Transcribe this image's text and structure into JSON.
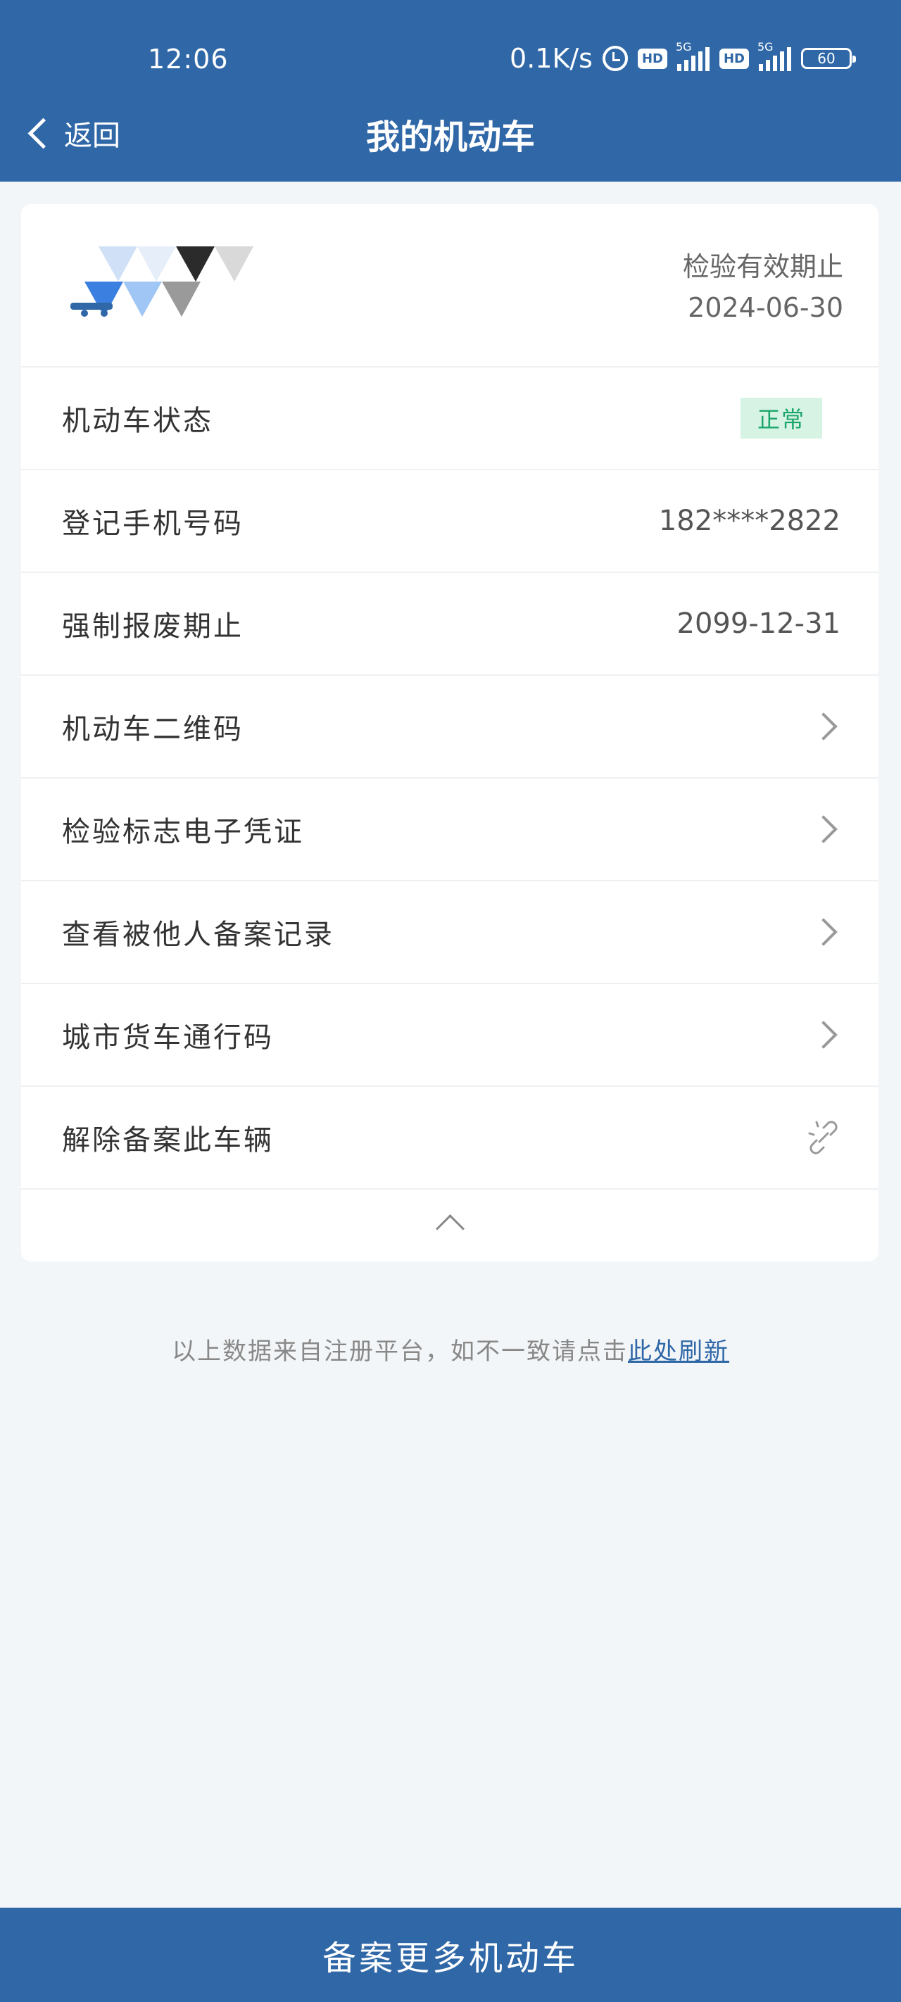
{
  "status_bar": {
    "time": "12:06",
    "net_speed": "0.1K/s",
    "hd_label": "HD",
    "net_label": "5G",
    "battery": "60"
  },
  "nav": {
    "back_label": "返回",
    "title": "我的机动车"
  },
  "vehicle": {
    "inspection_label": "检验有效期止",
    "inspection_date": "2024-06-30"
  },
  "rows": {
    "status_label": "机动车状态",
    "status_value": "正常",
    "phone_label": "登记手机号码",
    "phone_value": "182****2822",
    "scrap_label": "强制报废期止",
    "scrap_value": "2099-12-31",
    "qr_label": "机动车二维码",
    "e_cert_label": "检验标志电子凭证",
    "records_label": "查看被他人备案记录",
    "truck_pass_label": "城市货车通行码",
    "unbind_label": "解除备案此车辆"
  },
  "footer": {
    "note": "以上数据来自注册平台，如不一致请点击",
    "refresh_link": "此处刷新"
  },
  "bottom": {
    "register_more": "备案更多机动车"
  }
}
